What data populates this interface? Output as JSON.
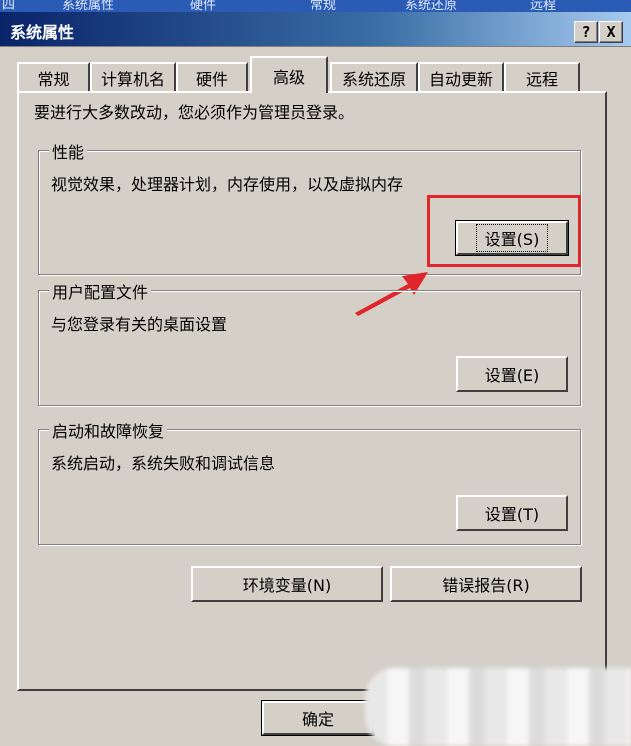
{
  "window": {
    "title": "系统属性",
    "help_button": "?",
    "close_button": "X"
  },
  "tabs": [
    "常规",
    "计算机名",
    "硬件",
    "高级",
    "系统还原",
    "自动更新",
    "远程"
  ],
  "active_tab": "高级",
  "note": "要进行大多数改动，您必须作为管理员登录。",
  "performance": {
    "title": "性能",
    "description": "视觉效果，处理器计划，内存使用，以及虚拟内存",
    "button": "设置(S)"
  },
  "user_profiles": {
    "title": "用户配置文件",
    "description": "与您登录有关的桌面设置",
    "button": "设置(E)"
  },
  "startup": {
    "title": "启动和故障恢复",
    "description": "系统启动，系统失败和调试信息",
    "button": "设置(T)"
  },
  "env_button": "环境变量(N)",
  "error_button": "错误报告(R)",
  "ok_button": "确定",
  "colors": {
    "highlight": "#e0262a",
    "titlebar": "#0a246a",
    "face": "#d4d0c8"
  }
}
